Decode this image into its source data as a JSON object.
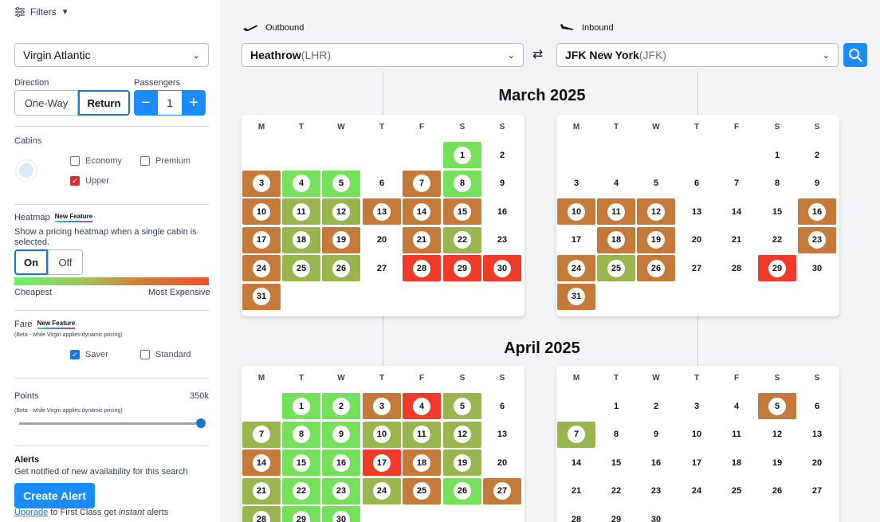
{
  "filters": {
    "label": "Filters"
  },
  "airline": {
    "value": "Virgin Atlantic"
  },
  "direction": {
    "label": "Direction",
    "one_way": "One-Way",
    "return": "Return"
  },
  "passengers": {
    "label": "Passengers",
    "minus": "−",
    "value": "1",
    "plus": "+"
  },
  "cabins": {
    "label": "Cabins",
    "economy": "Economy",
    "premium": "Premium",
    "upper": "Upper"
  },
  "heatmap": {
    "label": "Heatmap",
    "tag": "New Feature",
    "desc": "Show a pricing heatmap when a single cabin is selected.",
    "on": "On",
    "off": "Off",
    "cheap": "Cheapest",
    "expensive": "Most Expensive"
  },
  "fare": {
    "label": "Fare",
    "tag": "New Feature",
    "beta": "(Beta - while Virgin applies dynamic pricing)",
    "saver": "Saver",
    "standard": "Standard"
  },
  "points": {
    "label": "Points",
    "value": "350k",
    "beta": "(Beta - while Virgin applies dynamic pricing)"
  },
  "alerts": {
    "label": "Alerts",
    "desc": "Get notified of new availability for this search",
    "button": "Create Alert",
    "upgrade_link": "Upgrade",
    "upgrade_mid": " to First Class get ",
    "upgrade_em": "instant",
    "upgrade_end": " alerts"
  },
  "outbound": {
    "label": "Outbound",
    "city": "Heathrow",
    "code": " (LHR)"
  },
  "inbound": {
    "label": "Inbound",
    "city": "JFK New York",
    "code": " (JFK)"
  },
  "colors": {
    "green": "#75e05a",
    "olive": "#9ab44e",
    "orange": "#c47a3a",
    "red": "#f03a2a",
    "accent": "#1a8cff"
  },
  "weekdays": [
    "M",
    "T",
    "W",
    "T",
    "F",
    "S",
    "S"
  ],
  "months": [
    {
      "title": "March 2025",
      "calendars": [
        {
          "offset": 5,
          "days": 31,
          "heat": {
            "1": "green",
            "3": "orange",
            "4": "green",
            "5": "green",
            "7": "orange",
            "8": "green",
            "10": "orange",
            "11": "olive",
            "12": "olive",
            "13": "orange",
            "14": "orange",
            "15": "orange",
            "17": "orange",
            "18": "olive",
            "19": "orange",
            "21": "orange",
            "22": "olive",
            "24": "orange",
            "25": "olive",
            "26": "olive",
            "28": "red",
            "29": "red",
            "30": "red",
            "31": "orange"
          }
        },
        {
          "offset": 5,
          "days": 31,
          "heat": {
            "10": "orange",
            "11": "orange",
            "12": "orange",
            "16": "orange",
            "18": "orange",
            "19": "orange",
            "23": "orange",
            "24": "orange",
            "25": "olive",
            "26": "orange",
            "29": "red",
            "31": "orange"
          }
        }
      ]
    },
    {
      "title": "April 2025",
      "calendars": [
        {
          "offset": 1,
          "days": 30,
          "heat": {
            "1": "green",
            "2": "green",
            "3": "orange",
            "4": "red",
            "5": "olive",
            "7": "olive",
            "8": "green",
            "9": "green",
            "10": "olive",
            "11": "olive",
            "12": "olive",
            "14": "orange",
            "15": "green",
            "16": "green",
            "17": "red",
            "18": "orange",
            "19": "olive",
            "21": "olive",
            "22": "green",
            "23": "green",
            "24": "olive",
            "25": "orange",
            "26": "green",
            "27": "orange",
            "28": "olive",
            "29": "green",
            "30": "green"
          }
        },
        {
          "offset": 1,
          "days": 30,
          "heat": {
            "5": "orange",
            "7": "olive"
          }
        }
      ]
    }
  ]
}
